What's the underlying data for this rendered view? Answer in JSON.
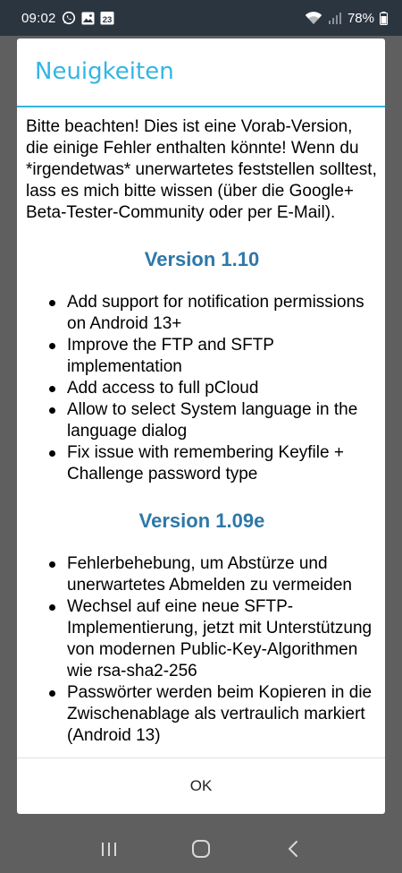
{
  "status_bar": {
    "time": "09:02",
    "battery_percent": "78%",
    "notification_icons": [
      "whatsapp-icon",
      "image-icon",
      "calendar-icon"
    ],
    "calendar_day": "23",
    "right_icons": [
      "wifi-icon",
      "signal-icon",
      "battery-icon"
    ]
  },
  "dialog": {
    "title": "Neuigkeiten",
    "title_color": "#33b5e5",
    "heading_color": "#2d78a8",
    "intro": "Bitte beachten! Dies ist eine Vorab-Version, die einige Fehler enthalten könnte! Wenn du *irgendetwas* unerwartetes feststellen solltest, lass es mich bitte wissen (über die Google+ Beta-Tester-Community oder per E-Mail).",
    "versions": [
      {
        "heading": "Version 1.10",
        "items": [
          "Add support for notification permissions on Android 13+",
          "Improve the FTP and SFTP implementation",
          "Add access to full pCloud",
          "Allow to select System language in the language dialog",
          "Fix issue with remembering Keyfile + Challenge password type"
        ]
      },
      {
        "heading": "Version 1.09e",
        "items": [
          "Fehlerbehebung, um Abstürze und unerwartetes Abmelden zu vermeiden",
          "Wechsel auf eine neue SFTP-Implementierung, jetzt mit Unterstützung von modernen Public-Key-Algorithmen wie rsa-sha2-256",
          "Passwörter werden beim Kopieren in die Zwischenablage als vertraulich markiert (Android 13)"
        ]
      }
    ],
    "ok_label": "OK"
  },
  "nav_bar": {
    "buttons": [
      "recents-icon",
      "home-icon",
      "back-icon"
    ]
  }
}
